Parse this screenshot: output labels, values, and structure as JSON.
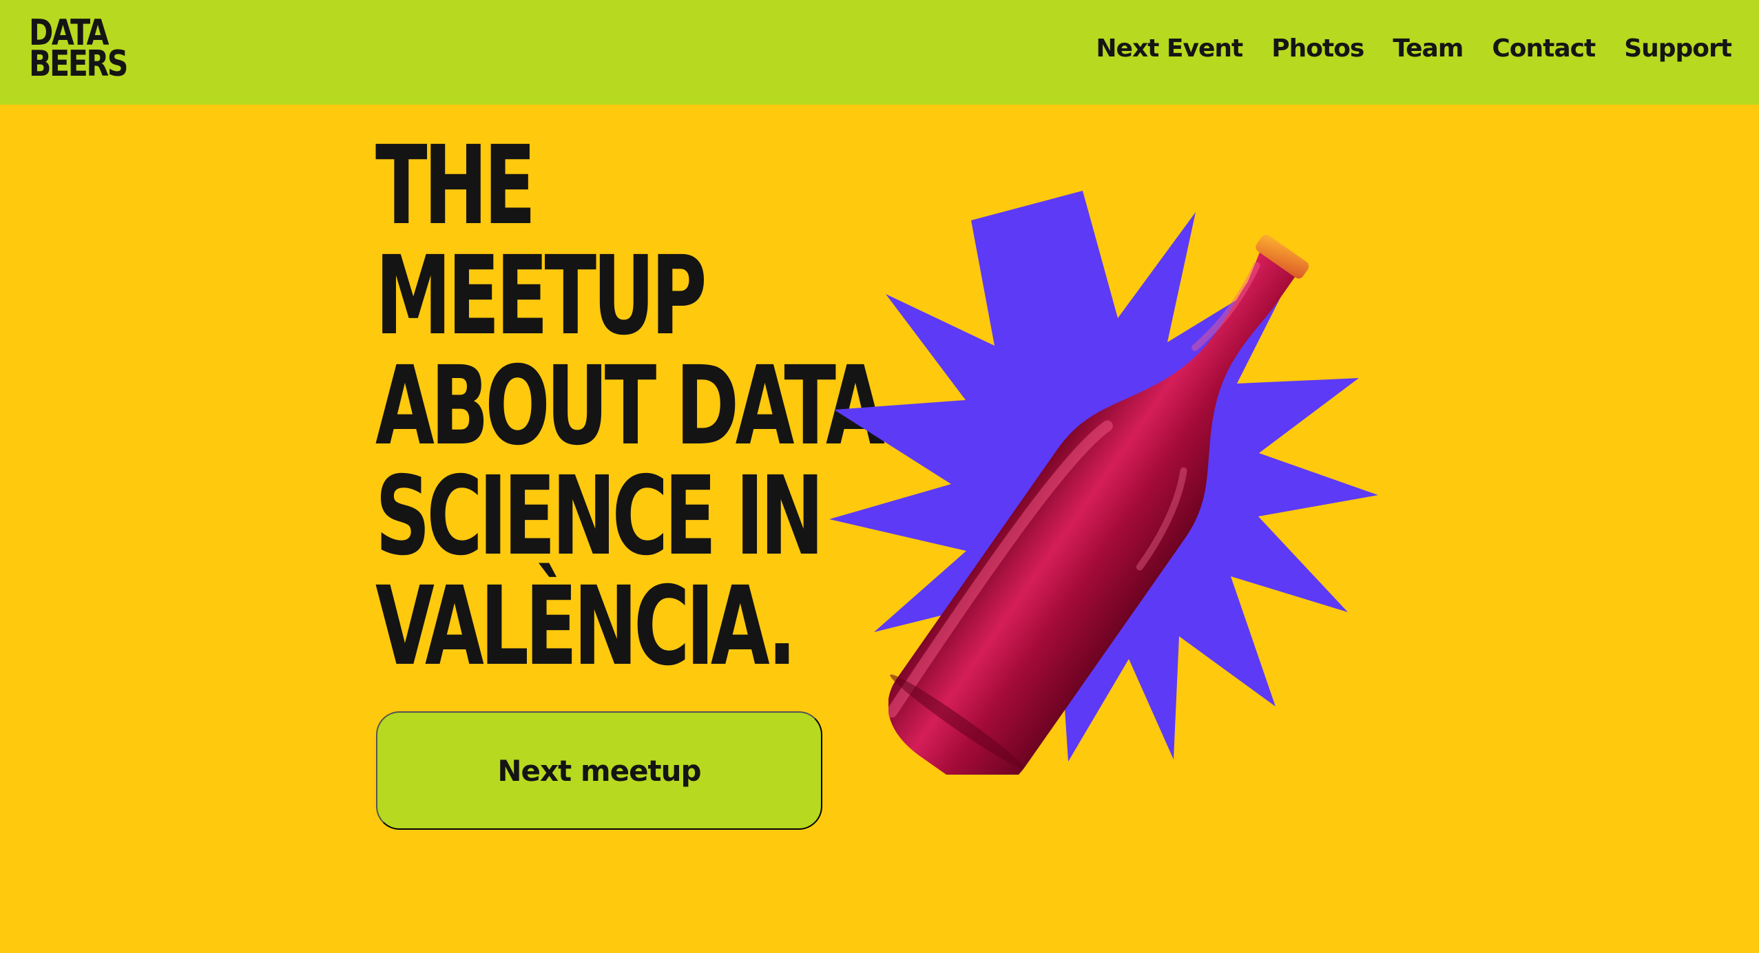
{
  "logo": {
    "line1": "DATA",
    "line2": "BEERS"
  },
  "nav": {
    "items": [
      {
        "label": "Next Event"
      },
      {
        "label": "Photos"
      },
      {
        "label": "Team"
      },
      {
        "label": "Contact"
      },
      {
        "label": "Support"
      }
    ]
  },
  "hero": {
    "title_lines": [
      "THE",
      "MEETUP",
      "ABOUT DATA",
      "SCIENCE IN",
      "VALÈNCIA."
    ],
    "cta_label": "Next meetup"
  },
  "colors": {
    "background": "#ffc90e",
    "topbar": "#b7d91f",
    "button": "#b7d91f",
    "text": "#141414",
    "burst": "#5d3af5",
    "bottle": "#c8144d"
  },
  "icons": {
    "burst": "star-burst-icon",
    "bottle": "beer-bottle-icon"
  }
}
